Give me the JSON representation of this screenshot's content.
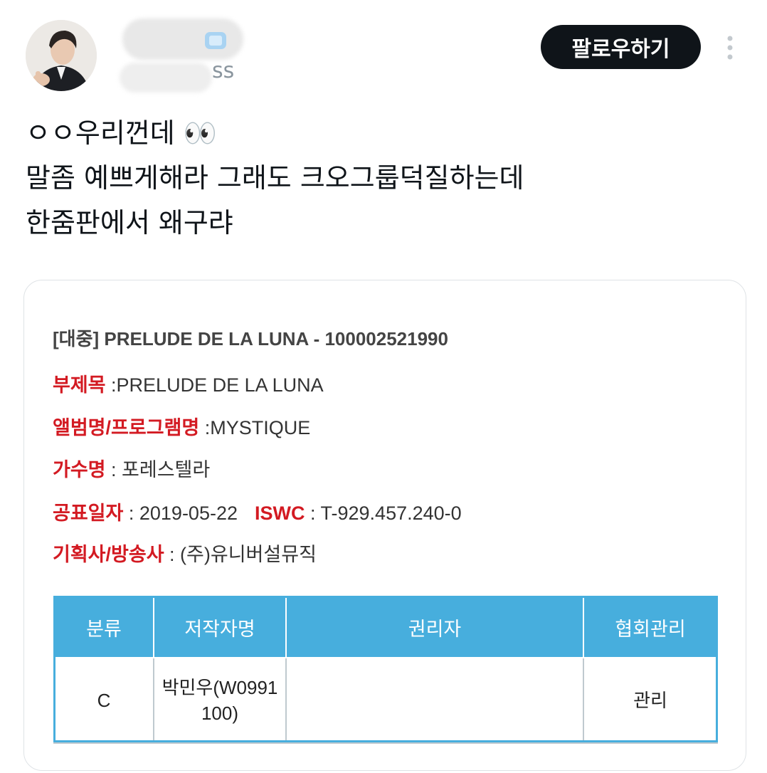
{
  "header": {
    "handle_suffix": "ss",
    "follow_label": "팔로우하기"
  },
  "tweet": {
    "lines": [
      "ㅇㅇ우리껀데 👀",
      "말좀 예쁘게해라 그래도 크오그룹덕질하는데",
      "한줌판에서 왜구랴"
    ]
  },
  "record": {
    "title": "[대중] PRELUDE DE LA LUNA - 100002521990",
    "subtitle_label": "부제목",
    "subtitle_value": " :PRELUDE DE LA LUNA",
    "album_label": "앨범명/프로그램명",
    "album_value": " :MYSTIQUE",
    "artist_label": "가수명",
    "artist_value": " : 포레스텔라",
    "date_label": "공표일자",
    "date_value": " : 2019-05-22",
    "iswc_label": "ISWC",
    "iswc_value": " : T-929.457.240-0",
    "company_label": "기획사/방송사",
    "company_value": " : (주)유니버설뮤직"
  },
  "table": {
    "headers": [
      "분류",
      "저작자명",
      "권리자",
      "협회관리"
    ],
    "rows": [
      {
        "category": "C",
        "author_line1": "박민우(W0991",
        "author_line2": "100)",
        "holder": "",
        "management": "관리"
      }
    ]
  },
  "colors": {
    "label_red": "#d31a22",
    "table_blue": "#47aedd",
    "button_dark": "#0f1419"
  }
}
